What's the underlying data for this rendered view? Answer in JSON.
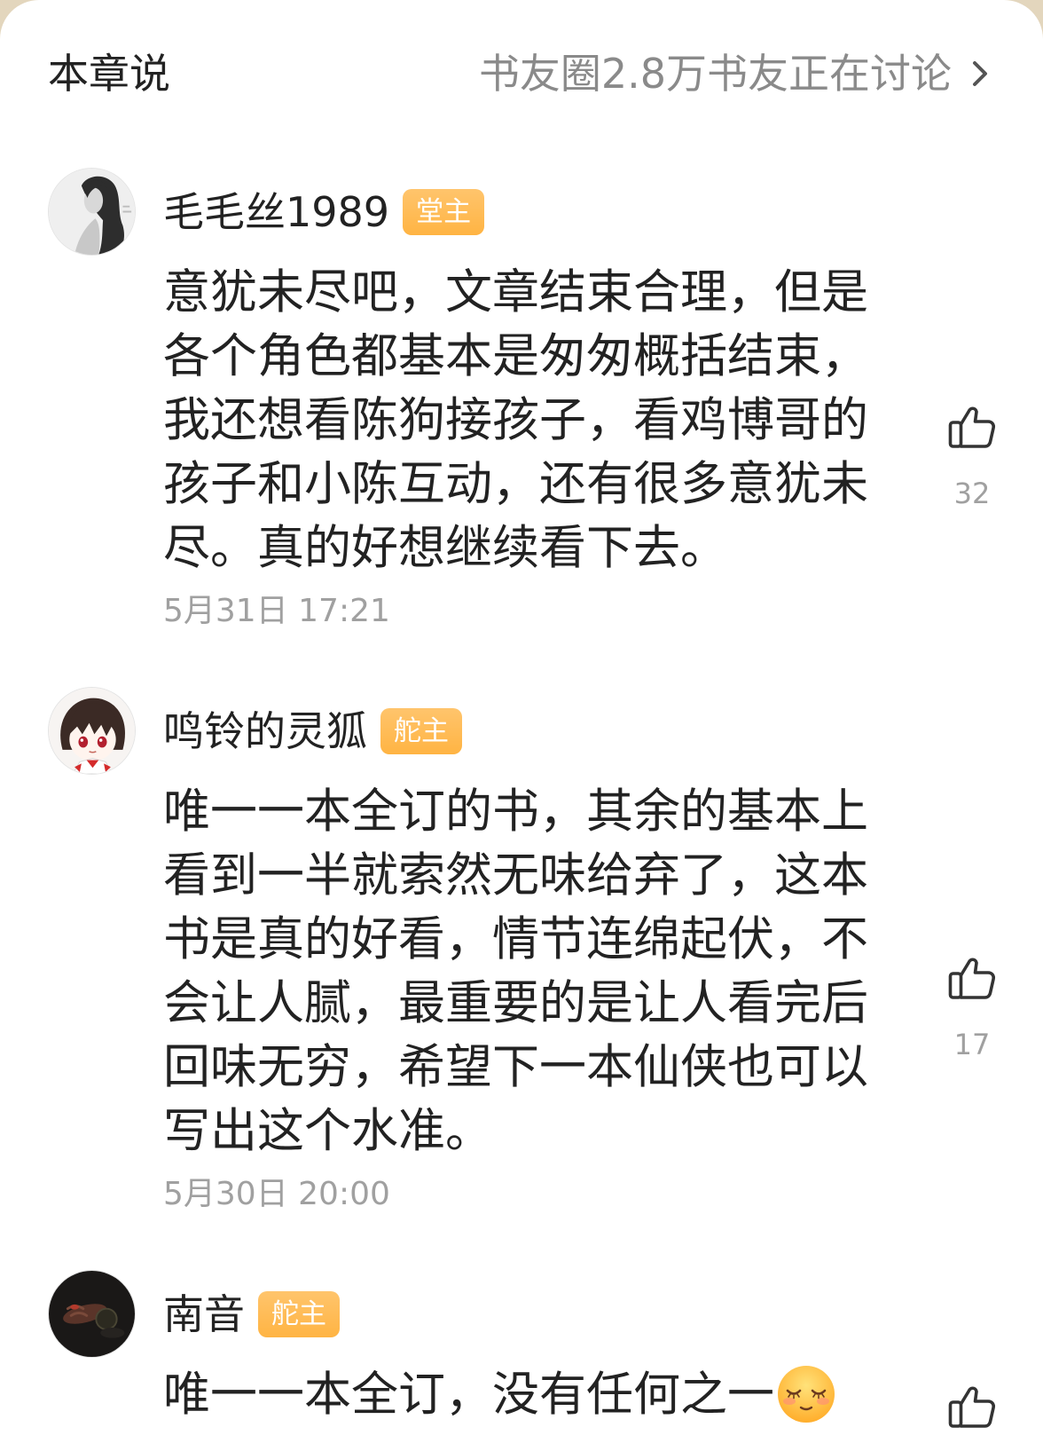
{
  "header": {
    "title": "本章说",
    "circle_link": "书友圈2.8万书友正在讨论",
    "chevron_icon": "chevron-right-icon"
  },
  "comments": [
    {
      "username": "毛毛丝1989",
      "badge": "堂主",
      "lines": [
        "意犹未尽吧，文章结束合理，但是",
        "各个角色都基本是匆匆概括结束，",
        "我还想看陈狗接孩子，看鸡博哥的",
        "孩子和小陈互动，还有很多意犹未",
        "尽。真的好想继续看下去。"
      ],
      "date": "5月31日 17:21",
      "like_icon": "thumbs-up-icon",
      "likes": 32
    },
    {
      "username": "鸣铃的灵狐",
      "badge": "舵主",
      "lines": [
        "唯一一本全订的书，其余的基本上",
        "看到一半就索然无味给弃了，这本",
        "书是真的好看，情节连绵起伏，不",
        "会让人腻，最重要的是让人看完后",
        "回味无穷，希望下一本仙侠也可以",
        "写出这个水准。"
      ],
      "date": "5月30日 20:00",
      "like_icon": "thumbs-up-icon",
      "likes": 17
    },
    {
      "username": "南音",
      "badge": "舵主",
      "lines": [
        "唯一一本全订，没有任何之一"
      ],
      "emoji": "relieved-face-icon",
      "like_icon": "thumbs-up-icon"
    }
  ],
  "colors": {
    "page_background": "#e3d6bd",
    "card": "#ffffff",
    "text": "#222222",
    "muted": "#a0a0a0",
    "link_gray": "#8a8a8a",
    "badge": "#ffb443",
    "badge_text": "#ffffff",
    "icon": "#333333"
  }
}
